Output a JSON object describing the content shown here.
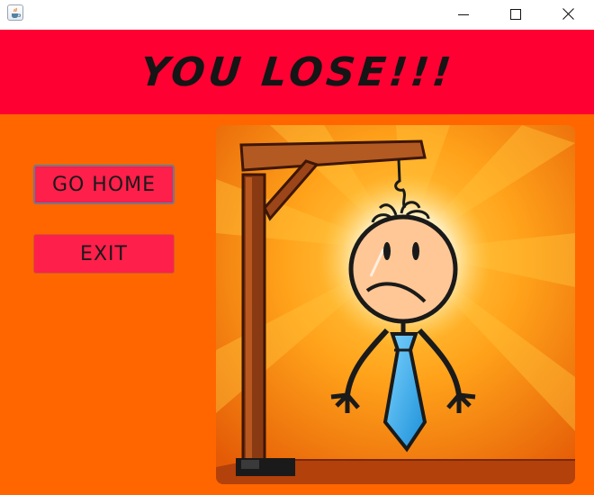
{
  "window": {
    "icon": "java-coffee-icon",
    "controls": {
      "minimize_icon": "minimize-icon",
      "maximize_icon": "maximize-icon",
      "close_icon": "close-icon"
    }
  },
  "banner": {
    "title": "YOU LOSE!!!",
    "background": "#ff0033"
  },
  "buttons": {
    "go_home": "GO HOME",
    "exit": "EXIT"
  },
  "colors": {
    "content_background": "#ff6600",
    "button_background": "#ff1f4b"
  },
  "image": {
    "subject": "hangman-stick-figure-image"
  }
}
